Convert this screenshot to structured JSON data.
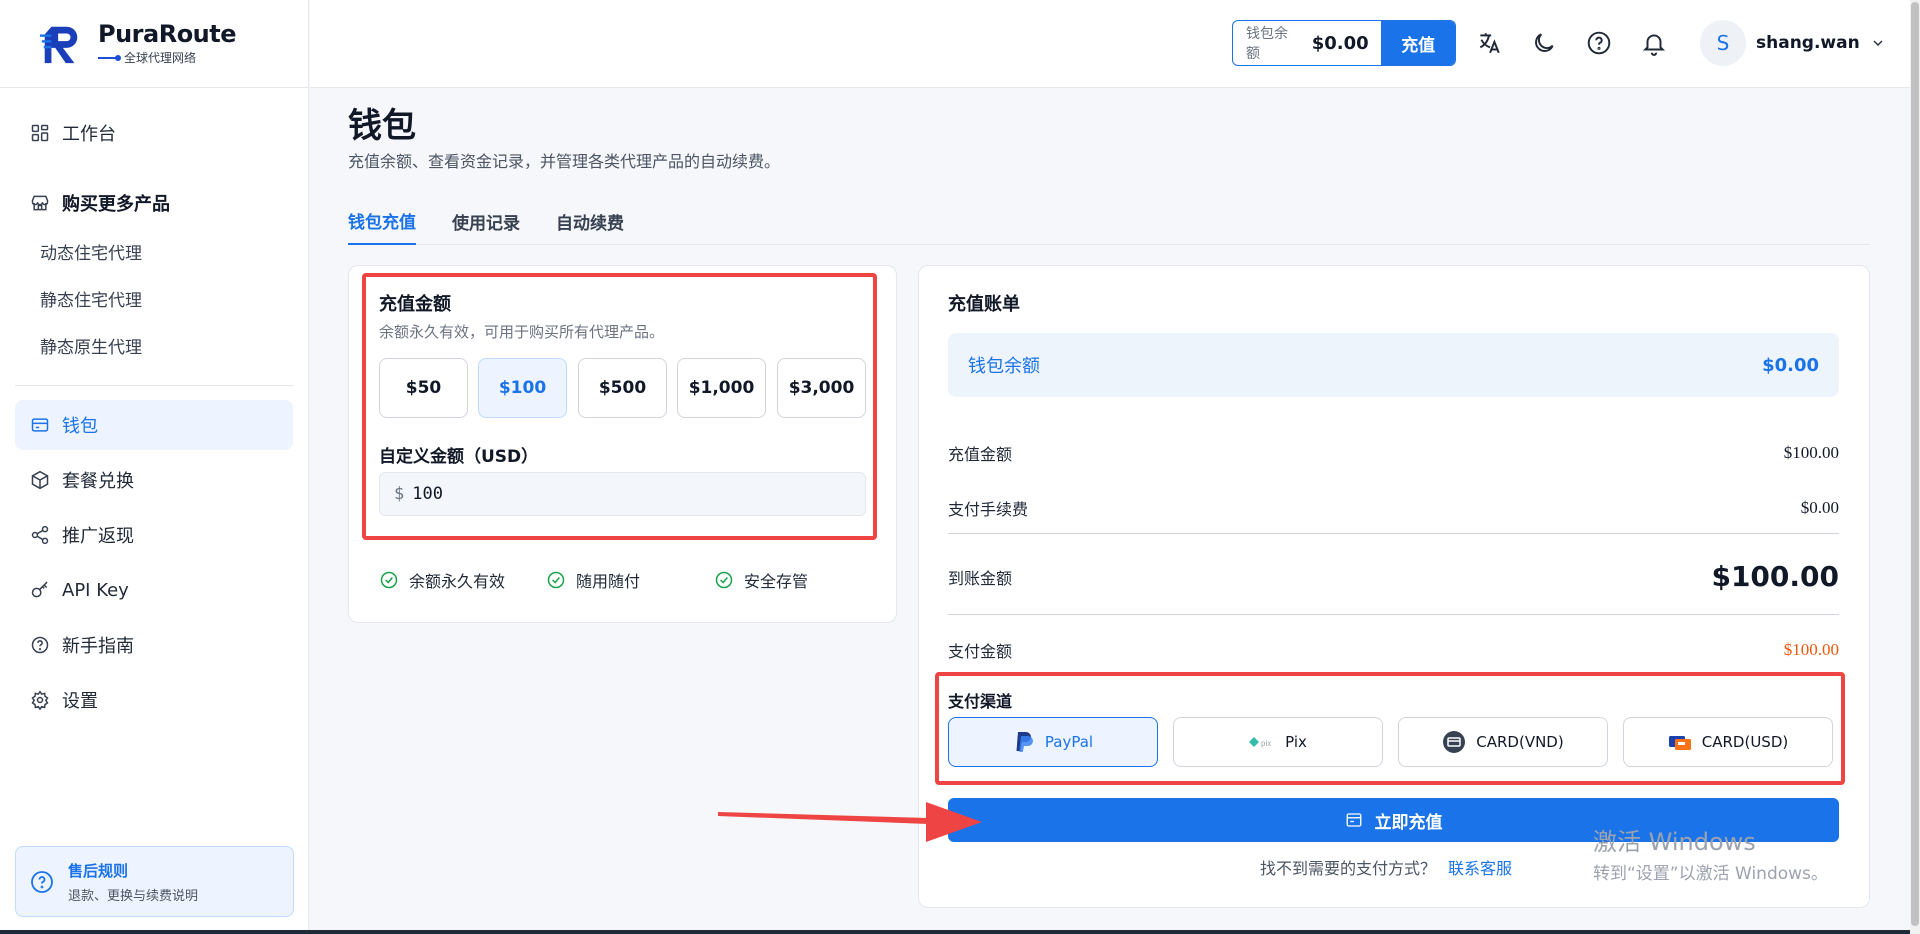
{
  "brand": {
    "name": "PuraRoute",
    "tagline": "全球代理网络"
  },
  "sidebar": {
    "dashboard": "工作台",
    "buy_more": "购买更多产品",
    "products": [
      "动态住宅代理",
      "静态住宅代理",
      "静态原生代理"
    ],
    "items": [
      {
        "label": "钱包",
        "icon": "wallet-icon",
        "active": true
      },
      {
        "label": "套餐兑换",
        "icon": "package-icon"
      },
      {
        "label": "推广返现",
        "icon": "share-icon"
      },
      {
        "label": "API Key",
        "icon": "key-icon"
      },
      {
        "label": "新手指南",
        "icon": "help-circle-icon"
      },
      {
        "label": "设置",
        "icon": "gear-icon"
      }
    ],
    "after_sale": {
      "title": "售后规则",
      "desc": "退款、更换与续费说明"
    }
  },
  "header": {
    "balance_label": "钱包余额",
    "balance_value": "$0.00",
    "recharge_label": "充值",
    "avatar_letter": "S",
    "username": "shang.wan"
  },
  "page": {
    "title": "钱包",
    "description": "充值余额、查看资金记录，并管理各类代理产品的自动续费。",
    "tabs": [
      "钱包充值",
      "使用记录",
      "自动续费"
    ]
  },
  "recharge": {
    "title": "充值金额",
    "desc": "余额永久有效，可用于购买所有代理产品。",
    "amounts": [
      "$50",
      "$100",
      "$500",
      "$1,000",
      "$3,000"
    ],
    "selected_amount": "$100",
    "custom_label": "自定义金额（USD）",
    "currency_symbol": "$",
    "custom_value": "100",
    "features": [
      "余额永久有效",
      "随用随付",
      "安全存管"
    ]
  },
  "bill": {
    "title": "充值账单",
    "wallet_label": "钱包余额",
    "wallet_value": "$0.00",
    "rows": [
      {
        "label": "充值金额",
        "value": "$100.00"
      },
      {
        "label": "支付手续费",
        "value": "$0.00"
      }
    ],
    "received_label": "到账金额",
    "received_value": "$100.00",
    "pay_amount_label": "支付金额",
    "pay_amount_value": "$100.00",
    "channel_title": "支付渠道",
    "channels": [
      "PayPal",
      "Pix",
      "CARD(VND)",
      "CARD(USD)"
    ],
    "selected_channel": "PayPal",
    "submit_label": "立即充值",
    "help_text": "找不到需要的支付方式？",
    "help_link": "联系客服"
  },
  "watermark": {
    "line1": "激活 Windows",
    "line2": "转到“设置”以激活 Windows。"
  },
  "colors": {
    "accent": "#1a73e8",
    "danger": "#ef4444",
    "success": "#16a34a",
    "price_red": "#ea580c"
  }
}
